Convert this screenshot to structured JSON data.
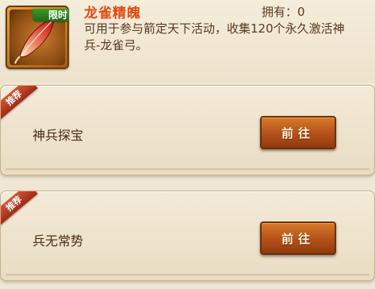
{
  "item": {
    "name": "龙雀精魄",
    "badge": "限时",
    "owned_text": "拥有：0",
    "description": "可用于参与箭定天下活动，收集120个永久激活神兵-龙雀弓。",
    "icon": "feather-icon"
  },
  "sources": [
    {
      "tag": "推荐",
      "title": "神兵探宝",
      "button_label": "前往"
    },
    {
      "tag": "推荐",
      "title": "兵无常势",
      "button_label": "前往"
    }
  ],
  "colors": {
    "title": "#e24a12",
    "button": "#b3501a",
    "ribbon": "#c2452a",
    "badge": "#2f8a24"
  }
}
